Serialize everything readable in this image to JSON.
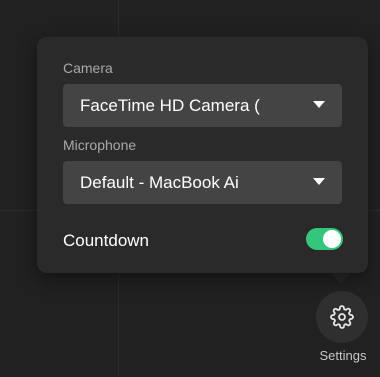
{
  "popover": {
    "camera": {
      "label": "Camera",
      "selected": "FaceTime HD Camera ("
    },
    "microphone": {
      "label": "Microphone",
      "selected": "Default - MacBook Ai"
    },
    "countdown": {
      "label": "Countdown",
      "enabled": true
    }
  },
  "settings_button": {
    "label": "Settings",
    "icon": "gear-icon"
  },
  "colors": {
    "toggle_on": "#34c77b",
    "popover_bg": "#2a2a2a",
    "select_bg": "#444444"
  }
}
